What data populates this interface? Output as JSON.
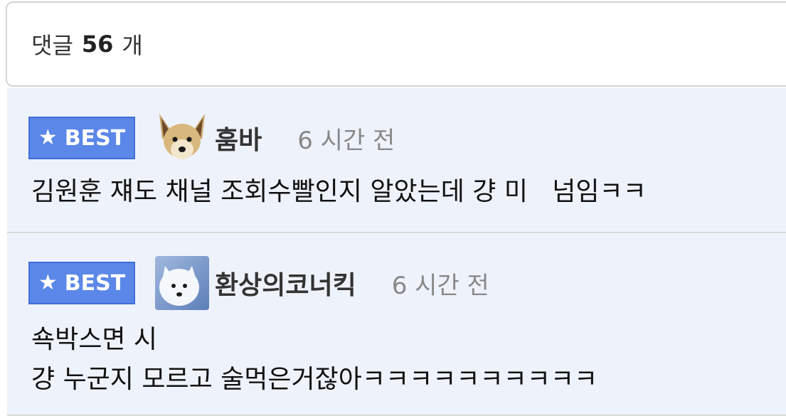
{
  "header": {
    "prefix": "댓글",
    "count": "56",
    "suffix": "개"
  },
  "comments": [
    {
      "badge": "BEST",
      "badge_icon": "star-icon",
      "avatar": "dog-avatar",
      "nickname": "훔바",
      "time": "6 시간 전",
      "lines": [
        "김원훈 쟤도 채널 조회수빨인지 알았는데 걍 미   넘임ㅋㅋ"
      ]
    },
    {
      "badge": "BEST",
      "badge_icon": "star-icon",
      "avatar": "white-fox-avatar",
      "nickname": "환상의코너킥",
      "time": "6 시간 전",
      "lines": [
        "쇽박스면 시",
        "걍 누군지 모르고 술먹은거잖아ㅋㅋㅋㅋㅋㅋㅋㅋㅋㅋ"
      ]
    }
  ],
  "colors": {
    "best_badge": "#5b87e8",
    "comment_bg": "#eef2fb",
    "time_text": "#888888"
  }
}
